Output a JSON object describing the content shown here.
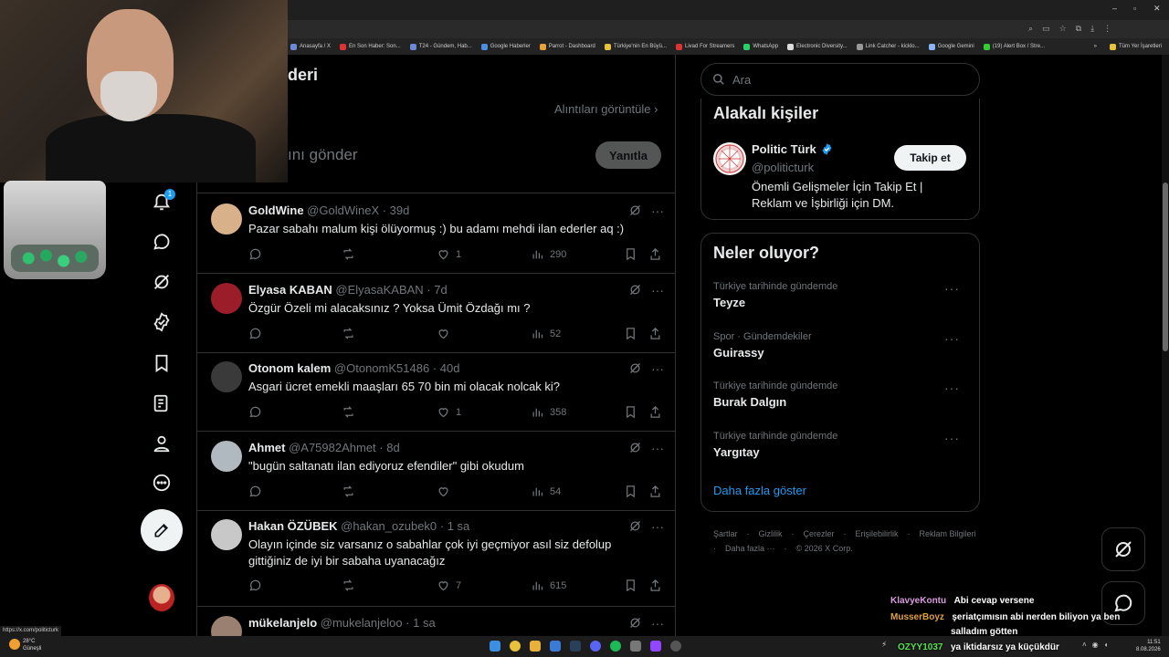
{
  "browser": {
    "bookmarks": [
      "Anasayfa / X",
      "En Son Haber: Son...",
      "T24 - Gündem, Hab...",
      "Google Haberler",
      "Parrot - Dashboard",
      "Türkiye'nin En Büyü...",
      "Livad For Streamers",
      "WhatsApp",
      "Electronic Diversity...",
      "Link Catcher - kicklo...",
      "Google Gemini",
      "(19) Alert Box / Stre..."
    ],
    "all_bookmarks": "Tüm Yer İşaretleri",
    "status_url": "https://x.com/politicturk"
  },
  "nav": {
    "notification_count": "1"
  },
  "page": {
    "title": "deri",
    "quotes_link": "Alıntıları görüntüle",
    "reply_placeholder": "ını gönder",
    "reply_button": "Yanıtla"
  },
  "tweets": [
    {
      "name": "GoldWine",
      "handle": "@GoldWineX · 39d",
      "text": "Pazar sabahı malum kişi ölüyormuş :) bu adamı mehdi ilan ederler aq :)",
      "likes": "1",
      "views": "290"
    },
    {
      "name": "Elyasa KABAN",
      "handle": "@ElyasaKABAN · 7d",
      "text": "Özgür Özeli mi alacaksınız ? Yoksa Ümit Özdağı mı ?",
      "likes": "",
      "views": "52"
    },
    {
      "name": "Otonom kalem",
      "handle": "@OtonomK51486 · 40d",
      "text": "Asgari ücret emekli maaşları 65 70 bin mi olacak nolcak ki?",
      "likes": "1",
      "views": "358"
    },
    {
      "name": "Ahmet",
      "handle": "@A75982Ahmet · 8d",
      "text": "\"bugün saltanatı ilan ediyoruz  efendiler\"  gibi okudum",
      "likes": "",
      "views": "54"
    },
    {
      "name": "Hakan ÖZÜBEK",
      "handle": "@hakan_ozubek0 · 1 sa",
      "text": "Olayın içinde siz varsanız o sabahlar çok iyi geçmiyor asıl siz defolup gittiğiniz de iyi bir sabaha uyanacağız",
      "likes": "7",
      "views": "615"
    },
    {
      "name": "mükelanjelo",
      "handle": "@mukelanjeloo · 1 sa",
      "text": "",
      "likes": "",
      "views": ""
    }
  ],
  "search": {
    "placeholder": "Ara"
  },
  "related": {
    "title": "Alakalı kişiler",
    "name": "Politic Türk",
    "handle": "@politicturk",
    "bio": "Önemli Gelişmeler İçin Takip Et | Reklam ve İşbirliği için DM.",
    "follow": "Takip et"
  },
  "trends": {
    "title": "Neler oluyor?",
    "items": [
      {
        "meta": "Türkiye tarihinde gündemde",
        "name": "Teyze"
      },
      {
        "meta": "Spor · Gündemdekiler",
        "name": "Guirassy"
      },
      {
        "meta": "Türkiye tarihinde gündemde",
        "name": "Burak Dalgın"
      },
      {
        "meta": "Türkiye tarihinde gündemde",
        "name": "Yargıtay"
      }
    ],
    "show_more": "Daha fazla göster"
  },
  "footer": {
    "links": [
      "Şartlar",
      "Gizlilik",
      "Çerezler",
      "Erişilebilirlik",
      "Reklam Bilgileri",
      "Daha fazla ···",
      "© 2026 X Corp."
    ]
  },
  "chat": [
    {
      "user": "KlavyeKontu",
      "msg": "Abi cevap versene",
      "color": "#d99be0"
    },
    {
      "user": "MusserBoyz",
      "msg": "şeriatçımısın abi nerden biliyon ya ben",
      "color": "#e0a040"
    },
    {
      "user": "",
      "msg": "salladım götten",
      "color": "#ffffff"
    },
    {
      "user": "OZYY1037",
      "msg": "ya iktidarsız ya küçükdür",
      "color": "#58e050"
    }
  ],
  "taskbar": {
    "weather_temp": "28°C",
    "weather_text": "Güneşli",
    "time": "11:51",
    "date": "8.08.2026"
  },
  "colors": {
    "accent": "#1d9bf0",
    "border": "#2f3336",
    "muted": "#71767b"
  }
}
